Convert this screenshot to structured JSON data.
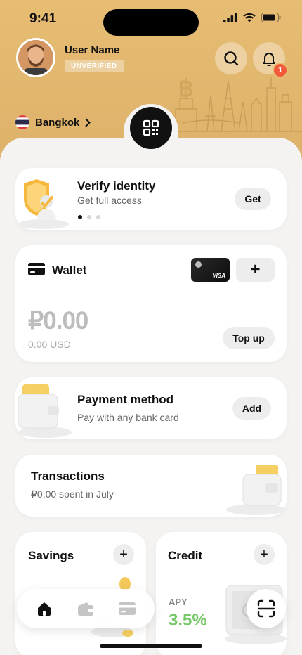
{
  "status_bar": {
    "time": "9:41"
  },
  "profile": {
    "name": "User Name",
    "badge": "UNVERIFIED"
  },
  "notifications": {
    "count": "1"
  },
  "location": {
    "flag": "thailand-flag-icon",
    "city": "Bangkok"
  },
  "verify_card": {
    "title": "Verify identity",
    "subtitle": "Get full access",
    "button": "Get",
    "pager": {
      "pages": 3,
      "active": 1
    }
  },
  "wallet_card": {
    "title": "Wallet",
    "card_brand": "VISA",
    "add_symbol": "+",
    "balance": "₽0.00",
    "balance_usd": "0.00 USD",
    "button": "Top up"
  },
  "payment_card": {
    "title": "Payment method",
    "subtitle": "Pay with any bank card",
    "button": "Add"
  },
  "transactions_card": {
    "title": "Transactions",
    "subtitle": "₽0,00 spent in July"
  },
  "savings_card": {
    "title": "Savings",
    "add_symbol": "+"
  },
  "credit_card": {
    "title": "Credit",
    "add_symbol": "+",
    "apy_label": "APY",
    "apy_value": "3.5%"
  },
  "tabbar": {
    "items": [
      "home-icon",
      "wallet-icon",
      "card-icon"
    ],
    "active": 0
  },
  "colors": {
    "header": "#e7bc73",
    "accent_green": "#78c86a",
    "notification": "#f25b3a"
  }
}
